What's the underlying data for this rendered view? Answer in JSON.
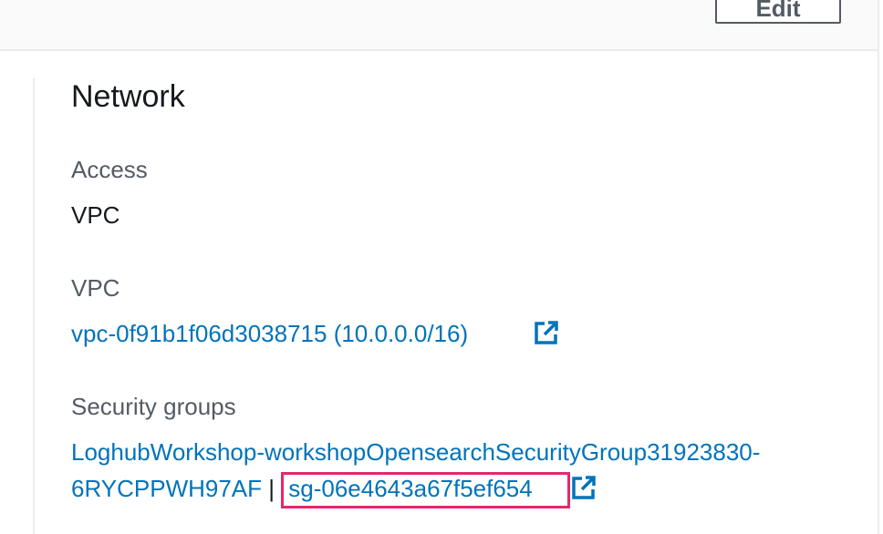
{
  "header": {
    "edit_label": "Edit"
  },
  "section": {
    "title": "Network"
  },
  "fields": {
    "access": {
      "label": "Access",
      "value": "VPC"
    },
    "vpc": {
      "label": "VPC",
      "value": "vpc-0f91b1f06d3038715 (10.0.0.0/16)",
      "icon": "external-link-icon"
    },
    "security_groups": {
      "label": "Security groups",
      "name_line1": "LoghubWorkshop-workshopOpensearchSecurityGroup31923830-",
      "name_line2": "6RYCPPWH97AF",
      "separator": "|",
      "id": "sg-06e4643a67f5ef654",
      "icon": "external-link-icon"
    }
  },
  "colors": {
    "link": "#0073bb",
    "label": "#545b64",
    "text": "#16191f",
    "highlight": "#e4286e"
  }
}
